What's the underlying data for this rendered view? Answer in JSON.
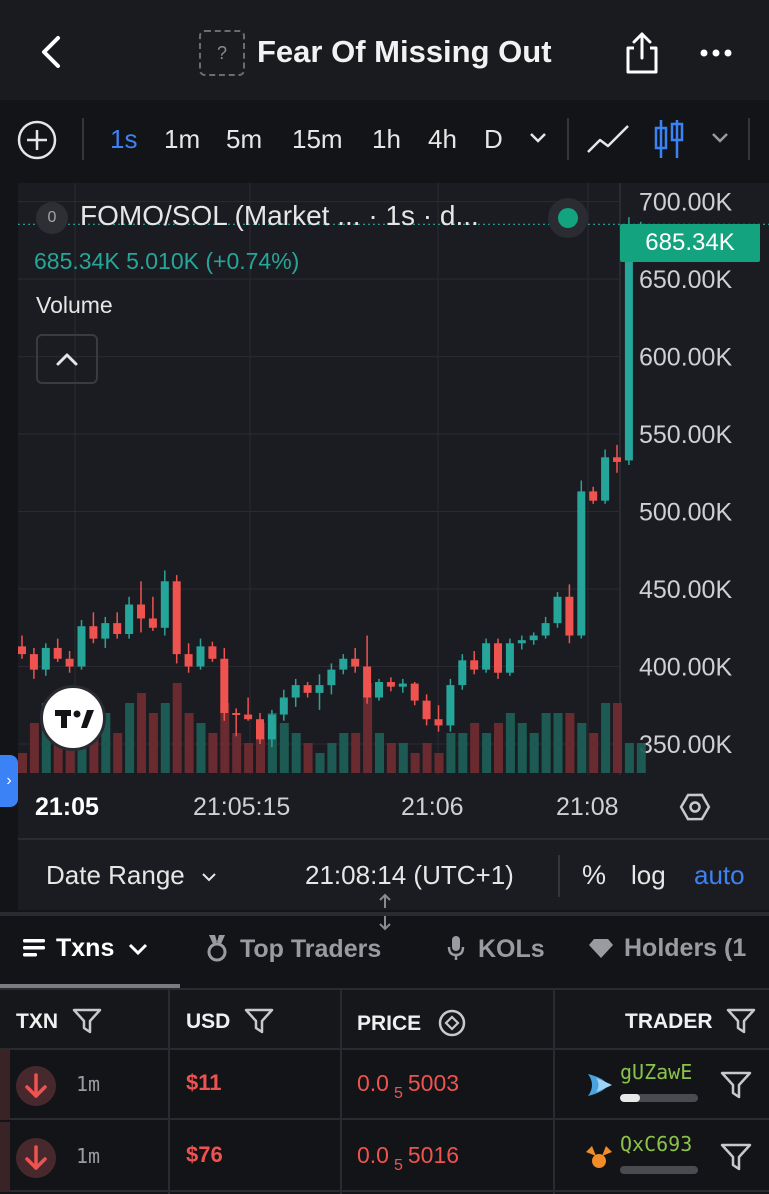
{
  "header": {
    "title": "Fear Of Missing Out",
    "token_icon_text": "?"
  },
  "toolbar": {
    "intervals": [
      "1s",
      "1m",
      "5m",
      "15m",
      "1h",
      "4h",
      "D"
    ],
    "active_interval": "1s"
  },
  "legend": {
    "badge": "0",
    "symbol": "FOMO/SOL (Market ... · 1s · d...",
    "values": "685.34K  5.010K (+0.74%)",
    "volume_label": "Volume"
  },
  "price_tag": "685.34K",
  "colors": {
    "up": "#26a69a",
    "down": "#ef5350",
    "accent": "#3b82f6"
  },
  "chart_data": {
    "type": "candlestick",
    "y_ticks": [
      "700.00K",
      "650.00K",
      "600.00K",
      "550.00K",
      "500.00K",
      "450.00K",
      "400.00K",
      "350.00K"
    ],
    "y_tick_values": [
      700,
      650,
      600,
      550,
      500,
      450,
      400,
      350
    ],
    "ylim": [
      330,
      712
    ],
    "x_ticks": [
      "21:05",
      "21:05:15",
      "21:06",
      "21:08"
    ],
    "last_price": 685.34,
    "candles": [
      {
        "o": 413,
        "h": 420,
        "l": 405,
        "c": 408,
        "v": 2
      },
      {
        "o": 408,
        "h": 412,
        "l": 392,
        "c": 398,
        "v": 5
      },
      {
        "o": 398,
        "h": 415,
        "l": 394,
        "c": 412,
        "v": 7
      },
      {
        "o": 412,
        "h": 418,
        "l": 403,
        "c": 405,
        "v": 5
      },
      {
        "o": 405,
        "h": 410,
        "l": 396,
        "c": 400,
        "v": 4
      },
      {
        "o": 400,
        "h": 430,
        "l": 398,
        "c": 426,
        "v": 6
      },
      {
        "o": 426,
        "h": 435,
        "l": 415,
        "c": 418,
        "v": 5
      },
      {
        "o": 418,
        "h": 432,
        "l": 412,
        "c": 428,
        "v": 6
      },
      {
        "o": 428,
        "h": 435,
        "l": 418,
        "c": 421,
        "v": 4
      },
      {
        "o": 421,
        "h": 445,
        "l": 418,
        "c": 440,
        "v": 7
      },
      {
        "o": 440,
        "h": 455,
        "l": 422,
        "c": 431,
        "v": 8
      },
      {
        "o": 431,
        "h": 445,
        "l": 423,
        "c": 425,
        "v": 6
      },
      {
        "o": 425,
        "h": 462,
        "l": 420,
        "c": 455,
        "v": 7
      },
      {
        "o": 455,
        "h": 459,
        "l": 402,
        "c": 408,
        "v": 9
      },
      {
        "o": 408,
        "h": 415,
        "l": 396,
        "c": 400,
        "v": 6
      },
      {
        "o": 400,
        "h": 418,
        "l": 398,
        "c": 413,
        "v": 5
      },
      {
        "o": 413,
        "h": 416,
        "l": 403,
        "c": 405,
        "v": 4
      },
      {
        "o": 405,
        "h": 412,
        "l": 365,
        "c": 370,
        "v": 7
      },
      {
        "o": 370,
        "h": 373,
        "l": 355,
        "c": 369,
        "v": 4
      },
      {
        "o": 369,
        "h": 380,
        "l": 365,
        "c": 366,
        "v": 3
      },
      {
        "o": 366,
        "h": 370,
        "l": 350,
        "c": 353,
        "v": 5
      },
      {
        "o": 353,
        "h": 372,
        "l": 348,
        "c": 369,
        "v": 6
      },
      {
        "o": 369,
        "h": 385,
        "l": 365,
        "c": 380,
        "v": 5
      },
      {
        "o": 380,
        "h": 392,
        "l": 374,
        "c": 388,
        "v": 4
      },
      {
        "o": 388,
        "h": 390,
        "l": 380,
        "c": 383,
        "v": 3
      },
      {
        "o": 383,
        "h": 395,
        "l": 372,
        "c": 388,
        "v": 2
      },
      {
        "o": 388,
        "h": 402,
        "l": 382,
        "c": 398,
        "v": 3
      },
      {
        "o": 398,
        "h": 408,
        "l": 395,
        "c": 405,
        "v": 4
      },
      {
        "o": 405,
        "h": 412,
        "l": 396,
        "c": 400,
        "v": 4
      },
      {
        "o": 400,
        "h": 420,
        "l": 376,
        "c": 380,
        "v": 9
      },
      {
        "o": 380,
        "h": 392,
        "l": 378,
        "c": 390,
        "v": 4
      },
      {
        "o": 390,
        "h": 393,
        "l": 384,
        "c": 387,
        "v": 3
      },
      {
        "o": 387,
        "h": 392,
        "l": 383,
        "c": 389,
        "v": 3
      },
      {
        "o": 389,
        "h": 390,
        "l": 375,
        "c": 378,
        "v": 2
      },
      {
        "o": 378,
        "h": 382,
        "l": 362,
        "c": 366,
        "v": 3
      },
      {
        "o": 366,
        "h": 375,
        "l": 358,
        "c": 362,
        "v": 2
      },
      {
        "o": 362,
        "h": 392,
        "l": 358,
        "c": 388,
        "v": 4
      },
      {
        "o": 388,
        "h": 408,
        "l": 385,
        "c": 404,
        "v": 4
      },
      {
        "o": 404,
        "h": 410,
        "l": 395,
        "c": 398,
        "v": 5
      },
      {
        "o": 398,
        "h": 418,
        "l": 396,
        "c": 415,
        "v": 4
      },
      {
        "o": 415,
        "h": 418,
        "l": 392,
        "c": 396,
        "v": 5
      },
      {
        "o": 396,
        "h": 418,
        "l": 394,
        "c": 415,
        "v": 6
      },
      {
        "o": 415,
        "h": 420,
        "l": 411,
        "c": 417,
        "v": 5
      },
      {
        "o": 417,
        "h": 422,
        "l": 414,
        "c": 420,
        "v": 4
      },
      {
        "o": 420,
        "h": 432,
        "l": 418,
        "c": 428,
        "v": 6
      },
      {
        "o": 428,
        "h": 448,
        "l": 425,
        "c": 445,
        "v": 6
      },
      {
        "o": 445,
        "h": 453,
        "l": 415,
        "c": 420,
        "v": 6
      },
      {
        "o": 420,
        "h": 520,
        "l": 418,
        "c": 513,
        "v": 5
      },
      {
        "o": 513,
        "h": 516,
        "l": 505,
        "c": 507,
        "v": 4
      },
      {
        "o": 507,
        "h": 540,
        "l": 505,
        "c": 535,
        "v": 7
      },
      {
        "o": 535,
        "h": 543,
        "l": 525,
        "c": 532,
        "v": 7
      },
      {
        "o": 533,
        "h": 690,
        "l": 530,
        "c": 680,
        "v": 3
      },
      {
        "o": 680,
        "h": 687,
        "l": 675,
        "c": 685.34,
        "v": 3
      }
    ]
  },
  "date_range": {
    "label": "Date Range",
    "clock": "21:08:14 (UTC+1)",
    "pct": "%",
    "log": "log",
    "auto": "auto"
  },
  "tabs": [
    {
      "label": "Txns"
    },
    {
      "label": "Top Traders"
    },
    {
      "label": "KOLs"
    },
    {
      "label": "Holders (1"
    }
  ],
  "table": {
    "columns": [
      "TXN",
      "USD",
      "PRICE",
      "TRADER"
    ],
    "rows": [
      {
        "age": "1m",
        "usd": "$11",
        "price_a": "0.0",
        "price_sub": "5",
        "price_b": "5003",
        "trader": "gUZawE",
        "trader_fill": 0.25
      },
      {
        "age": "1m",
        "usd": "$76",
        "price_a": "0.0",
        "price_sub": "5",
        "price_b": "5016",
        "trader": "QxC693",
        "trader_fill": 0.0
      }
    ]
  }
}
